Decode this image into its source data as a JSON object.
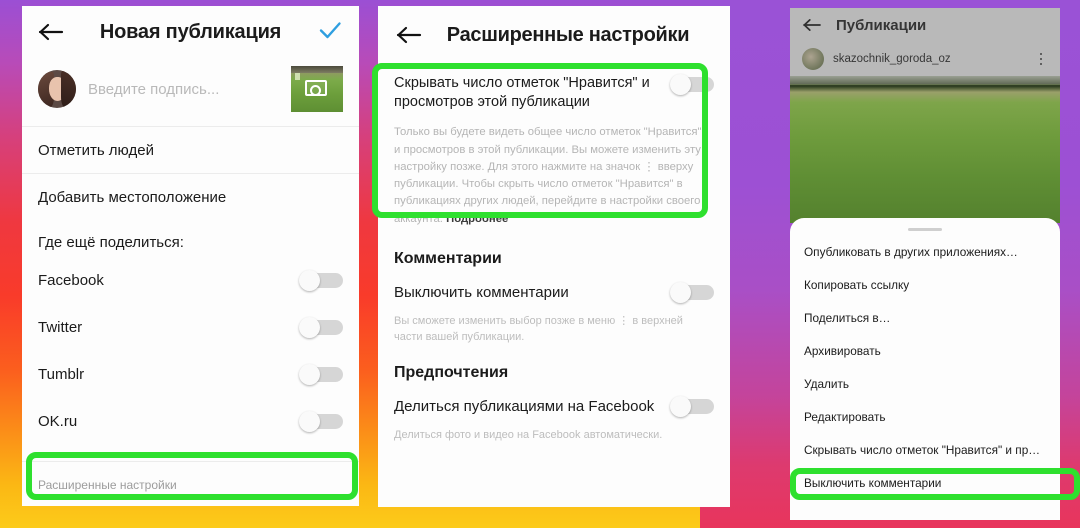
{
  "colors": {
    "highlight_green": "#2ee02e",
    "accent_blue": "#2f9fe0",
    "bg_gradient_start": "#9b4fd4",
    "bg_gradient_end": "#fccb1a"
  },
  "panel1": {
    "name": "new-post-screen",
    "back_icon": "back-arrow-icon",
    "title": "Новая публикация",
    "confirm_icon": "checkmark-icon",
    "caption_placeholder": "Введите подпись...",
    "avatar": "user-avatar",
    "thumbnail": "post-thumbnail",
    "rows": [
      {
        "label": "Отметить людей"
      },
      {
        "label": "Добавить местоположение"
      }
    ],
    "share_section_label": "Где ещё поделиться:",
    "share_targets": [
      {
        "label": "Facebook",
        "enabled": false
      },
      {
        "label": "Twitter",
        "enabled": false
      },
      {
        "label": "Tumblr",
        "enabled": false
      },
      {
        "label": "OK.ru",
        "enabled": false
      }
    ],
    "advanced_settings_label": "Расширенные настройки"
  },
  "panel2": {
    "name": "advanced-settings-screen",
    "back_icon": "back-arrow-icon",
    "title": "Расширенные настройки",
    "hide_likes": {
      "title": "Скрывать число отметок \"Нравится\" и просмотров этой публикации",
      "enabled": false,
      "description": "Только вы будете видеть общее число отметок \"Нравится\" и просмотров в этой публикации. Вы можете изменить эту настройку позже. Для этого нажмите на значок ⋮ вверху публикации. Чтобы скрыть число отметок \"Нравится\" в публикациях других людей, перейдите в настройки своего аккаунта.",
      "link_label": "Подробнее"
    },
    "comments_section": "Комментарии",
    "disable_comments": {
      "label": "Выключить комментарии",
      "enabled": false,
      "note": "Вы сможете изменить выбор позже в меню ⋮ в верхней части вашей публикации."
    },
    "preferences_section": "Предпочтения",
    "share_facebook": {
      "label": "Делиться публикациями на Facebook",
      "enabled": false,
      "note": "Делиться фото и видео на Facebook автоматически."
    }
  },
  "panel3": {
    "name": "post-view-screen",
    "back_icon": "back-arrow-icon",
    "title": "Публикации",
    "username": "skazochnik_goroda_oz",
    "more_icon": "more-vertical-icon",
    "avatar": "post-author-avatar",
    "photo": "field-photo",
    "sheet": {
      "handle": "sheet-drag-handle",
      "items": [
        {
          "label": "Опубликовать в других приложениях…"
        },
        {
          "label": "Копировать ссылку"
        },
        {
          "label": "Поделиться в…"
        },
        {
          "label": "Архивировать"
        },
        {
          "label": "Удалить"
        },
        {
          "label": "Редактировать"
        },
        {
          "label": "Скрывать число отметок \"Нравится\" и пр…"
        },
        {
          "label": "Выключить комментарии"
        }
      ]
    }
  }
}
